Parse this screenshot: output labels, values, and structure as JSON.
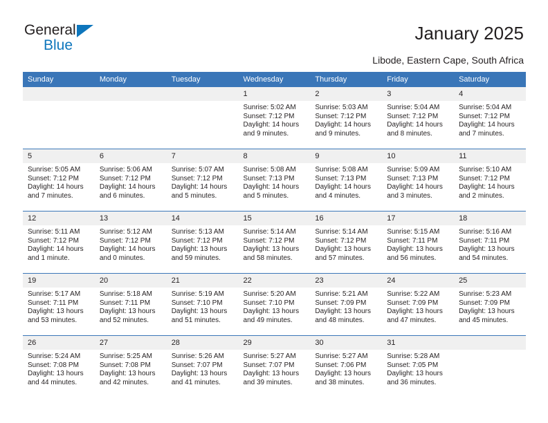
{
  "brand": {
    "general": "General",
    "blue": "Blue",
    "accent_color": "#0e76bc"
  },
  "header": {
    "title": "January 2025",
    "subtitle": "Libode, Eastern Cape, South Africa"
  },
  "theme": {
    "header_bg": "#3a76b8",
    "daynum_bg": "#f0f0f0",
    "grid_line": "#3a76b8",
    "text": "#231f20"
  },
  "weekday_headers": [
    "Sunday",
    "Monday",
    "Tuesday",
    "Wednesday",
    "Thursday",
    "Friday",
    "Saturday"
  ],
  "weeks": [
    [
      {
        "day": "",
        "empty": true,
        "sunrise": "",
        "sunset": "",
        "daylight_line1": "",
        "daylight_line2": ""
      },
      {
        "day": "",
        "empty": true,
        "sunrise": "",
        "sunset": "",
        "daylight_line1": "",
        "daylight_line2": ""
      },
      {
        "day": "",
        "empty": true,
        "sunrise": "",
        "sunset": "",
        "daylight_line1": "",
        "daylight_line2": ""
      },
      {
        "day": "1",
        "empty": false,
        "sunrise": "Sunrise: 5:02 AM",
        "sunset": "Sunset: 7:12 PM",
        "daylight_line1": "Daylight: 14 hours",
        "daylight_line2": "and 9 minutes."
      },
      {
        "day": "2",
        "empty": false,
        "sunrise": "Sunrise: 5:03 AM",
        "sunset": "Sunset: 7:12 PM",
        "daylight_line1": "Daylight: 14 hours",
        "daylight_line2": "and 9 minutes."
      },
      {
        "day": "3",
        "empty": false,
        "sunrise": "Sunrise: 5:04 AM",
        "sunset": "Sunset: 7:12 PM",
        "daylight_line1": "Daylight: 14 hours",
        "daylight_line2": "and 8 minutes."
      },
      {
        "day": "4",
        "empty": false,
        "sunrise": "Sunrise: 5:04 AM",
        "sunset": "Sunset: 7:12 PM",
        "daylight_line1": "Daylight: 14 hours",
        "daylight_line2": "and 7 minutes."
      }
    ],
    [
      {
        "day": "5",
        "empty": false,
        "sunrise": "Sunrise: 5:05 AM",
        "sunset": "Sunset: 7:12 PM",
        "daylight_line1": "Daylight: 14 hours",
        "daylight_line2": "and 7 minutes."
      },
      {
        "day": "6",
        "empty": false,
        "sunrise": "Sunrise: 5:06 AM",
        "sunset": "Sunset: 7:12 PM",
        "daylight_line1": "Daylight: 14 hours",
        "daylight_line2": "and 6 minutes."
      },
      {
        "day": "7",
        "empty": false,
        "sunrise": "Sunrise: 5:07 AM",
        "sunset": "Sunset: 7:12 PM",
        "daylight_line1": "Daylight: 14 hours",
        "daylight_line2": "and 5 minutes."
      },
      {
        "day": "8",
        "empty": false,
        "sunrise": "Sunrise: 5:08 AM",
        "sunset": "Sunset: 7:13 PM",
        "daylight_line1": "Daylight: 14 hours",
        "daylight_line2": "and 5 minutes."
      },
      {
        "day": "9",
        "empty": false,
        "sunrise": "Sunrise: 5:08 AM",
        "sunset": "Sunset: 7:13 PM",
        "daylight_line1": "Daylight: 14 hours",
        "daylight_line2": "and 4 minutes."
      },
      {
        "day": "10",
        "empty": false,
        "sunrise": "Sunrise: 5:09 AM",
        "sunset": "Sunset: 7:13 PM",
        "daylight_line1": "Daylight: 14 hours",
        "daylight_line2": "and 3 minutes."
      },
      {
        "day": "11",
        "empty": false,
        "sunrise": "Sunrise: 5:10 AM",
        "sunset": "Sunset: 7:12 PM",
        "daylight_line1": "Daylight: 14 hours",
        "daylight_line2": "and 2 minutes."
      }
    ],
    [
      {
        "day": "12",
        "empty": false,
        "sunrise": "Sunrise: 5:11 AM",
        "sunset": "Sunset: 7:12 PM",
        "daylight_line1": "Daylight: 14 hours",
        "daylight_line2": "and 1 minute."
      },
      {
        "day": "13",
        "empty": false,
        "sunrise": "Sunrise: 5:12 AM",
        "sunset": "Sunset: 7:12 PM",
        "daylight_line1": "Daylight: 14 hours",
        "daylight_line2": "and 0 minutes."
      },
      {
        "day": "14",
        "empty": false,
        "sunrise": "Sunrise: 5:13 AM",
        "sunset": "Sunset: 7:12 PM",
        "daylight_line1": "Daylight: 13 hours",
        "daylight_line2": "and 59 minutes."
      },
      {
        "day": "15",
        "empty": false,
        "sunrise": "Sunrise: 5:14 AM",
        "sunset": "Sunset: 7:12 PM",
        "daylight_line1": "Daylight: 13 hours",
        "daylight_line2": "and 58 minutes."
      },
      {
        "day": "16",
        "empty": false,
        "sunrise": "Sunrise: 5:14 AM",
        "sunset": "Sunset: 7:12 PM",
        "daylight_line1": "Daylight: 13 hours",
        "daylight_line2": "and 57 minutes."
      },
      {
        "day": "17",
        "empty": false,
        "sunrise": "Sunrise: 5:15 AM",
        "sunset": "Sunset: 7:11 PM",
        "daylight_line1": "Daylight: 13 hours",
        "daylight_line2": "and 56 minutes."
      },
      {
        "day": "18",
        "empty": false,
        "sunrise": "Sunrise: 5:16 AM",
        "sunset": "Sunset: 7:11 PM",
        "daylight_line1": "Daylight: 13 hours",
        "daylight_line2": "and 54 minutes."
      }
    ],
    [
      {
        "day": "19",
        "empty": false,
        "sunrise": "Sunrise: 5:17 AM",
        "sunset": "Sunset: 7:11 PM",
        "daylight_line1": "Daylight: 13 hours",
        "daylight_line2": "and 53 minutes."
      },
      {
        "day": "20",
        "empty": false,
        "sunrise": "Sunrise: 5:18 AM",
        "sunset": "Sunset: 7:11 PM",
        "daylight_line1": "Daylight: 13 hours",
        "daylight_line2": "and 52 minutes."
      },
      {
        "day": "21",
        "empty": false,
        "sunrise": "Sunrise: 5:19 AM",
        "sunset": "Sunset: 7:10 PM",
        "daylight_line1": "Daylight: 13 hours",
        "daylight_line2": "and 51 minutes."
      },
      {
        "day": "22",
        "empty": false,
        "sunrise": "Sunrise: 5:20 AM",
        "sunset": "Sunset: 7:10 PM",
        "daylight_line1": "Daylight: 13 hours",
        "daylight_line2": "and 49 minutes."
      },
      {
        "day": "23",
        "empty": false,
        "sunrise": "Sunrise: 5:21 AM",
        "sunset": "Sunset: 7:09 PM",
        "daylight_line1": "Daylight: 13 hours",
        "daylight_line2": "and 48 minutes."
      },
      {
        "day": "24",
        "empty": false,
        "sunrise": "Sunrise: 5:22 AM",
        "sunset": "Sunset: 7:09 PM",
        "daylight_line1": "Daylight: 13 hours",
        "daylight_line2": "and 47 minutes."
      },
      {
        "day": "25",
        "empty": false,
        "sunrise": "Sunrise: 5:23 AM",
        "sunset": "Sunset: 7:09 PM",
        "daylight_line1": "Daylight: 13 hours",
        "daylight_line2": "and 45 minutes."
      }
    ],
    [
      {
        "day": "26",
        "empty": false,
        "sunrise": "Sunrise: 5:24 AM",
        "sunset": "Sunset: 7:08 PM",
        "daylight_line1": "Daylight: 13 hours",
        "daylight_line2": "and 44 minutes."
      },
      {
        "day": "27",
        "empty": false,
        "sunrise": "Sunrise: 5:25 AM",
        "sunset": "Sunset: 7:08 PM",
        "daylight_line1": "Daylight: 13 hours",
        "daylight_line2": "and 42 minutes."
      },
      {
        "day": "28",
        "empty": false,
        "sunrise": "Sunrise: 5:26 AM",
        "sunset": "Sunset: 7:07 PM",
        "daylight_line1": "Daylight: 13 hours",
        "daylight_line2": "and 41 minutes."
      },
      {
        "day": "29",
        "empty": false,
        "sunrise": "Sunrise: 5:27 AM",
        "sunset": "Sunset: 7:07 PM",
        "daylight_line1": "Daylight: 13 hours",
        "daylight_line2": "and 39 minutes."
      },
      {
        "day": "30",
        "empty": false,
        "sunrise": "Sunrise: 5:27 AM",
        "sunset": "Sunset: 7:06 PM",
        "daylight_line1": "Daylight: 13 hours",
        "daylight_line2": "and 38 minutes."
      },
      {
        "day": "31",
        "empty": false,
        "sunrise": "Sunrise: 5:28 AM",
        "sunset": "Sunset: 7:05 PM",
        "daylight_line1": "Daylight: 13 hours",
        "daylight_line2": "and 36 minutes."
      },
      {
        "day": "",
        "empty": true,
        "sunrise": "",
        "sunset": "",
        "daylight_line1": "",
        "daylight_line2": ""
      }
    ]
  ]
}
